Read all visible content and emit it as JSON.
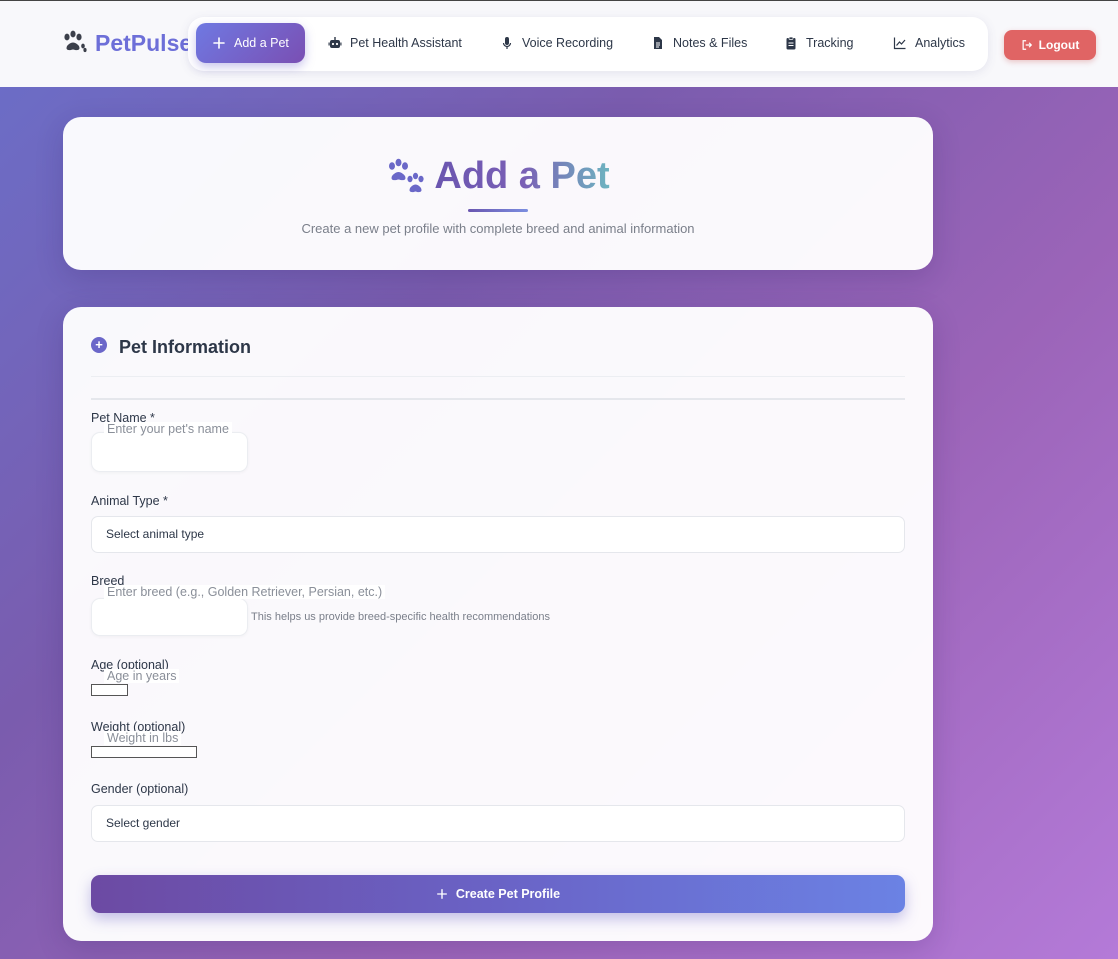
{
  "brand": {
    "name": "PetPulse",
    "icon": "paw-icon"
  },
  "nav": {
    "items": [
      {
        "label": "Add a Pet",
        "icon": "plus-icon",
        "active": true
      },
      {
        "label": "Pet Health Assistant",
        "icon": "robot-icon"
      },
      {
        "label": "Voice Recording",
        "icon": "microphone-icon"
      },
      {
        "label": "Notes & Files",
        "icon": "file-icon"
      },
      {
        "label": "Tracking",
        "icon": "clipboard-icon"
      },
      {
        "label": "Analytics",
        "icon": "line-chart-icon"
      }
    ],
    "logout_label": "Logout"
  },
  "hero": {
    "title": "Add a Pet",
    "subtitle": "Create a new pet profile with complete breed and animal information"
  },
  "form": {
    "section_title": "Pet Information",
    "pet_name": {
      "label": "Pet Name *",
      "placeholder": "Enter your pet's name"
    },
    "animal_type": {
      "label": "Animal Type *",
      "value": "Select animal type"
    },
    "breed": {
      "label": "Breed",
      "placeholder": "Enter breed (e.g., Golden Retriever, Persian, etc.)",
      "hint": "This helps us provide breed-specific health recommendations"
    },
    "age": {
      "label": "Age (optional)",
      "placeholder": "Age in years"
    },
    "weight": {
      "label": "Weight (optional)",
      "placeholder": "Weight in lbs"
    },
    "gender": {
      "label": "Gender (optional)",
      "value": "Select gender"
    },
    "submit_label": "Create Pet Profile"
  },
  "colors": {
    "accent": "#6d6fd8",
    "logout": "#e06464",
    "button_gradient_start": "#6c4aa3",
    "button_gradient_end": "#6b82e4"
  }
}
